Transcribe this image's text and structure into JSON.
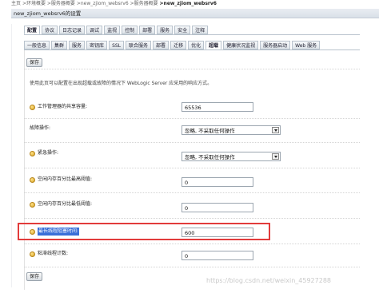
{
  "breadcrumb": {
    "items": [
      "主页",
      ">环境概要",
      ">服务器概要",
      ">new_zjiom_websrv6",
      ">服务器概要",
      ">new_zjiom_websrv6"
    ]
  },
  "window": {
    "title": "new_zjiom_websrv6的设置"
  },
  "tabs": {
    "primary": [
      "配置",
      "协议",
      "日志记录",
      "调试",
      "监视",
      "控制",
      "部署",
      "服务",
      "安全",
      "注释"
    ],
    "secondary": [
      "一般信息",
      "集群",
      "服务",
      "密钥库",
      "SSL",
      "联合服务",
      "部署",
      "迁移",
      "优化",
      "超载",
      "健康状况监视",
      "服务器启动",
      "Web 服务"
    ]
  },
  "buttons": {
    "save_top": "保存",
    "save_bottom": "保存"
  },
  "description": "使用此页可以配置在出现超载或故障的情况下 WebLogic Server 应采用的响应方式。",
  "fields": {
    "shared_capacity": {
      "label": "工作管理器的共享容量:",
      "value": "65536"
    },
    "failure_action": {
      "label": "故障操作:",
      "value": "忽略, 不采取任何操作"
    },
    "panic_action": {
      "label": "紧急操作:",
      "value": "忽略, 不采取任何操作"
    },
    "free_memory_high": {
      "label": "空闲内存百分比最高阈值:",
      "value": "0"
    },
    "free_memory_low": {
      "label": "空闲内存百分比最低阈值:",
      "value": "0"
    },
    "max_stuck_time": {
      "label": "最长线程阻塞时间:",
      "value": "600"
    },
    "stuck_thread_count": {
      "label": "粘滞线程计数:",
      "value": "0"
    }
  },
  "watermark": "https://blog.csdn.net/weixin_45927288",
  "colors": {
    "highlight_border": "#e23b3b",
    "selection": "#3a6fd8"
  }
}
